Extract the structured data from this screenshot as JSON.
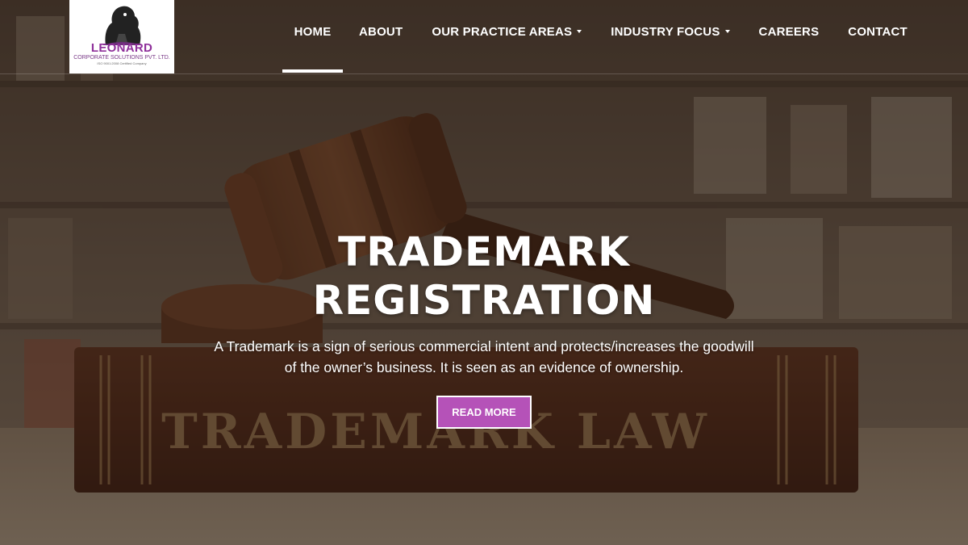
{
  "logo": {
    "name": "LEONARD",
    "subtitle": "CORPORATE SOLUTIONS PVT. LTD.",
    "certification": "ISO 9001:2008 Certified Company"
  },
  "nav": {
    "home": "HOME",
    "about": "ABOUT",
    "practice_areas": "OUR PRACTICE AREAS",
    "industry_focus": "INDUSTRY FOCUS",
    "careers": "CAREERS",
    "contact": "CONTACT",
    "active": "HOME"
  },
  "hero": {
    "title_line1": "TRADEMARK",
    "title_line2": "REGISTRATION",
    "text_line1": "A Trademark is a sign of serious commercial intent and protects/increases the goodwill",
    "text_line2": "of the owner’s business. It is seen as an evidence of ownership.",
    "button_label": "READ MORE",
    "book_spine_text": "TRADEMARK LAW"
  },
  "colors": {
    "accent": "#b552b8",
    "logo_purple": "#8e2f9a",
    "text": "#ffffff"
  }
}
